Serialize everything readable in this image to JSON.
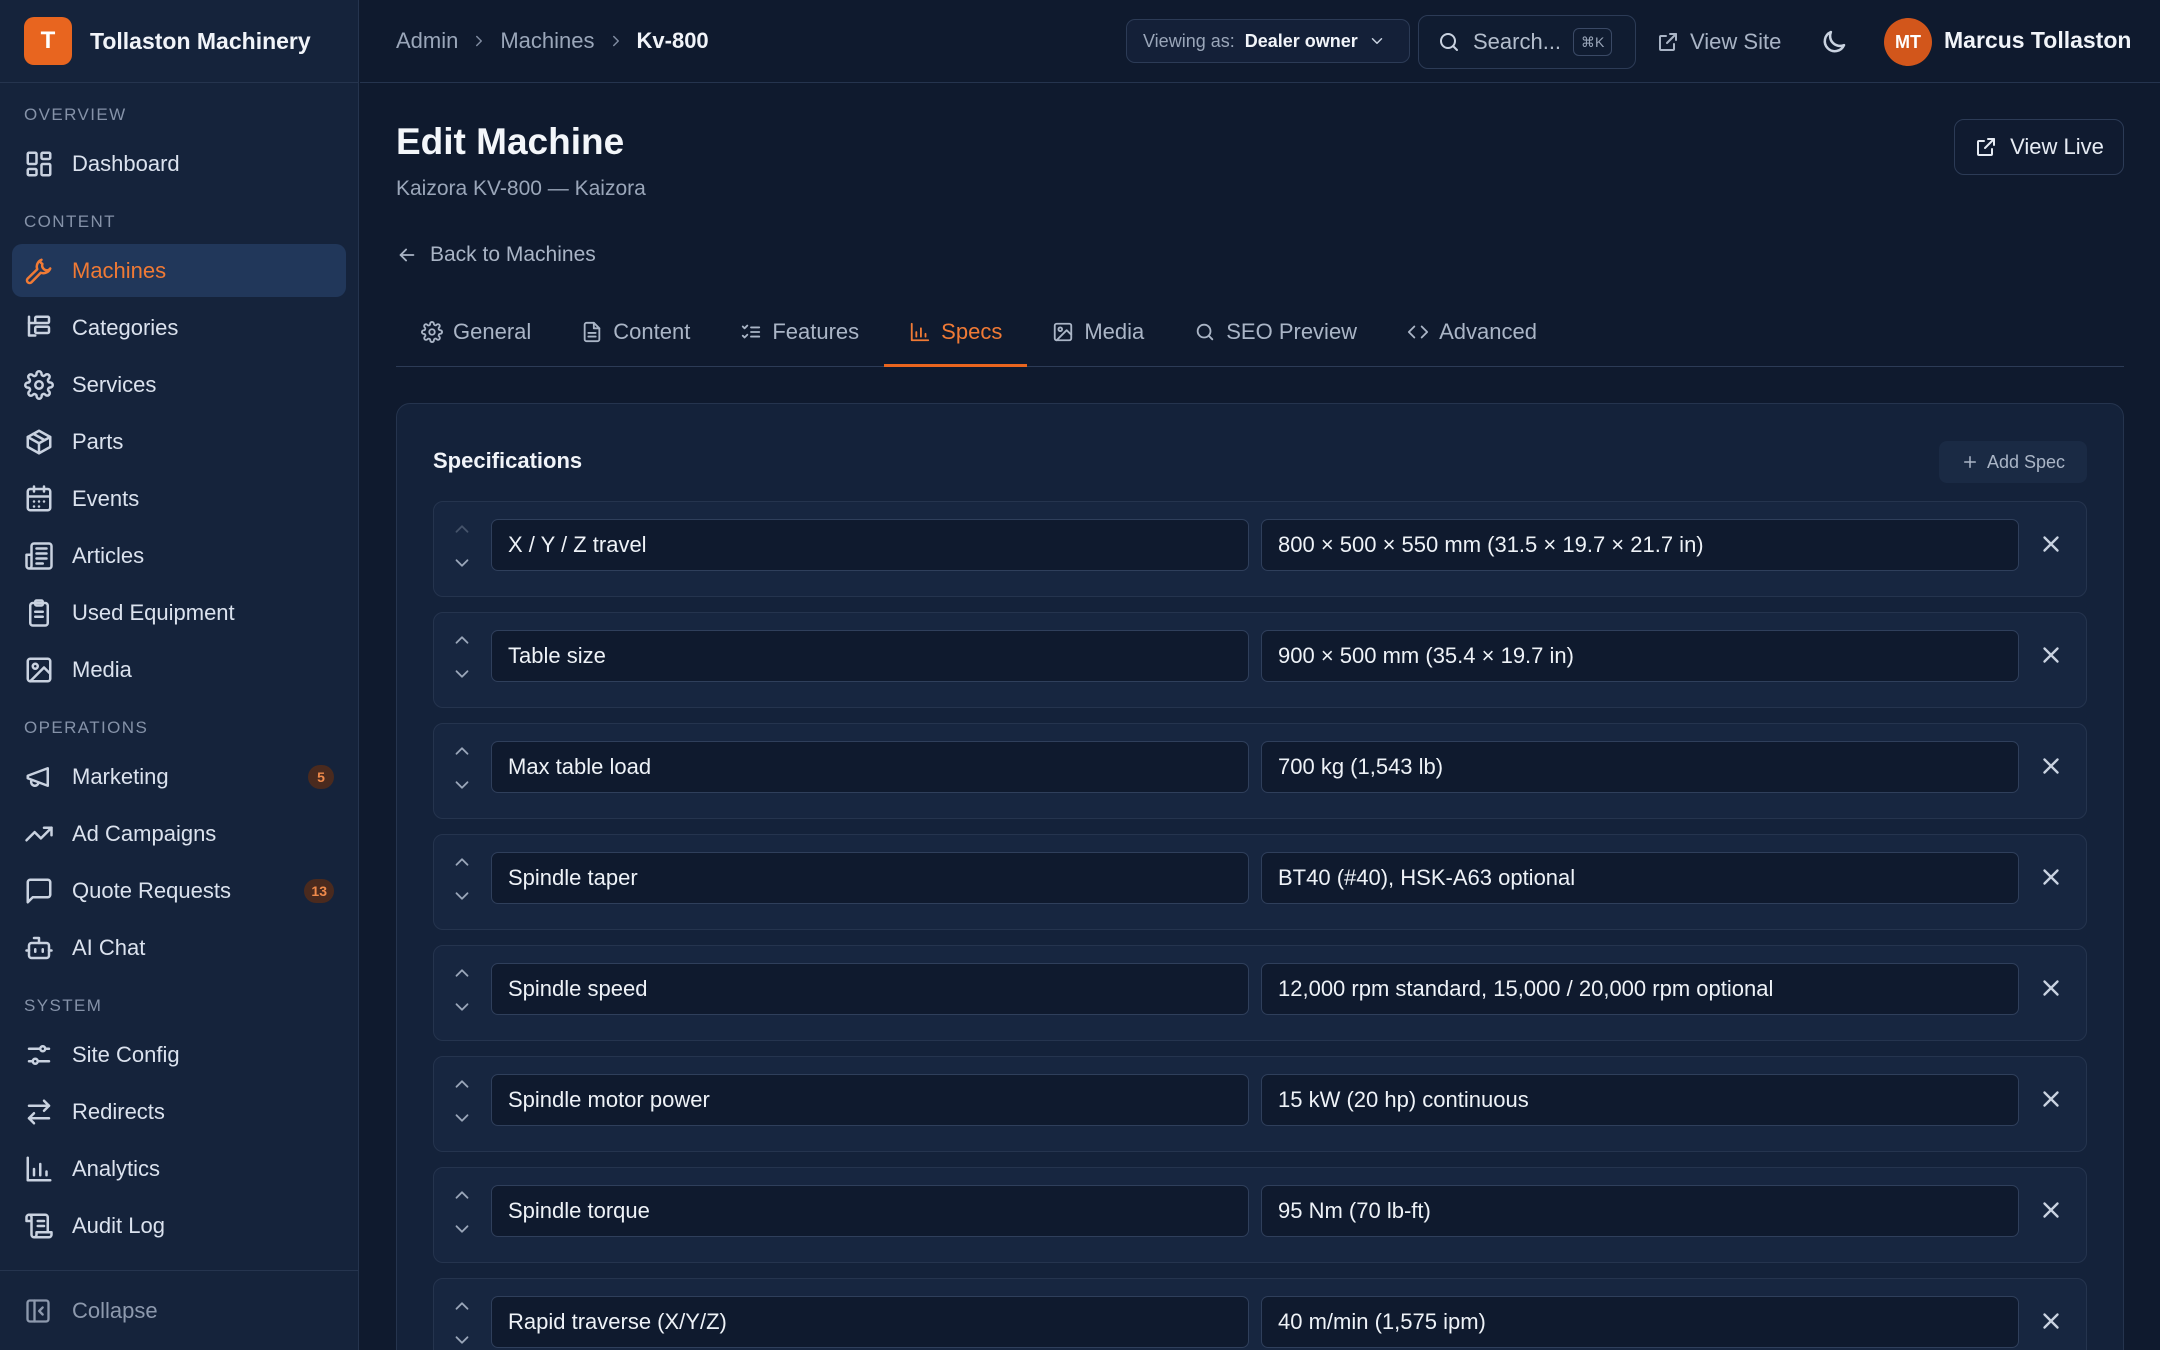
{
  "brand": {
    "logo_letter": "T",
    "name": "Tollaston Machinery",
    "accent": "#e8651f"
  },
  "sidebar": {
    "sections": [
      {
        "label": "OVERVIEW",
        "items": [
          {
            "label": "Dashboard",
            "icon": "dashboard-icon"
          }
        ]
      },
      {
        "label": "CONTENT",
        "items": [
          {
            "label": "Machines",
            "icon": "wrench-icon",
            "active": true
          },
          {
            "label": "Categories",
            "icon": "categories-icon"
          },
          {
            "label": "Services",
            "icon": "gear-icon"
          },
          {
            "label": "Parts",
            "icon": "package-icon"
          },
          {
            "label": "Events",
            "icon": "calendar-icon"
          },
          {
            "label": "Articles",
            "icon": "newspaper-icon"
          },
          {
            "label": "Used Equipment",
            "icon": "clipboard-icon"
          },
          {
            "label": "Media",
            "icon": "image-icon"
          }
        ]
      },
      {
        "label": "OPERATIONS",
        "items": [
          {
            "label": "Marketing",
            "icon": "megaphone-icon",
            "badge": "5"
          },
          {
            "label": "Ad Campaigns",
            "icon": "trending-up-icon"
          },
          {
            "label": "Quote Requests",
            "icon": "message-icon",
            "badge": "13"
          },
          {
            "label": "AI Chat",
            "icon": "bot-icon"
          }
        ]
      },
      {
        "label": "SYSTEM",
        "items": [
          {
            "label": "Site Config",
            "icon": "sliders-icon"
          },
          {
            "label": "Redirects",
            "icon": "arrows-icon"
          },
          {
            "label": "Analytics",
            "icon": "bar-chart-icon"
          },
          {
            "label": "Audit Log",
            "icon": "scroll-icon"
          }
        ]
      }
    ],
    "collapse_label": "Collapse"
  },
  "topbar": {
    "breadcrumbs": [
      "Admin",
      "Machines",
      "Kv-800"
    ],
    "viewing_as_label": "Viewing as:",
    "viewing_as_value": "Dealer owner",
    "search_placeholder": "Search...",
    "search_shortcut": "⌘K",
    "view_site_label": "View Site",
    "user_initials": "MT",
    "user_name": "Marcus Tollaston"
  },
  "page": {
    "title": "Edit Machine",
    "subtitle": "Kaizora KV-800 — Kaizora",
    "view_live_label": "View Live",
    "back_label": "Back to Machines"
  },
  "tabs": [
    {
      "label": "General",
      "icon": "settings-icon"
    },
    {
      "label": "Content",
      "icon": "file-text-icon"
    },
    {
      "label": "Features",
      "icon": "list-checks-icon"
    },
    {
      "label": "Specs",
      "icon": "bar-chart-icon",
      "active": true
    },
    {
      "label": "Media",
      "icon": "image-icon"
    },
    {
      "label": "SEO Preview",
      "icon": "search-icon"
    },
    {
      "label": "Advanced",
      "icon": "code-icon"
    }
  ],
  "specs": {
    "title": "Specifications",
    "add_label": "Add Spec",
    "rows": [
      {
        "key": "X / Y / Z travel",
        "value": "800 × 500 × 550 mm (31.5 × 19.7 × 21.7 in)"
      },
      {
        "key": "Table size",
        "value": "900 × 500 mm (35.4 × 19.7 in)"
      },
      {
        "key": "Max table load",
        "value": "700 kg (1,543 lb)"
      },
      {
        "key": "Spindle taper",
        "value": "BT40 (#40), HSK-A63 optional"
      },
      {
        "key": "Spindle speed",
        "value": "12,000 rpm standard, 15,000 / 20,000 rpm optional"
      },
      {
        "key": "Spindle motor power",
        "value": "15 kW (20 hp) continuous"
      },
      {
        "key": "Spindle torque",
        "value": "95 Nm (70 lb-ft)"
      },
      {
        "key": "Rapid traverse (X/Y/Z)",
        "value": "40 m/min (1,575 ipm)"
      }
    ]
  }
}
